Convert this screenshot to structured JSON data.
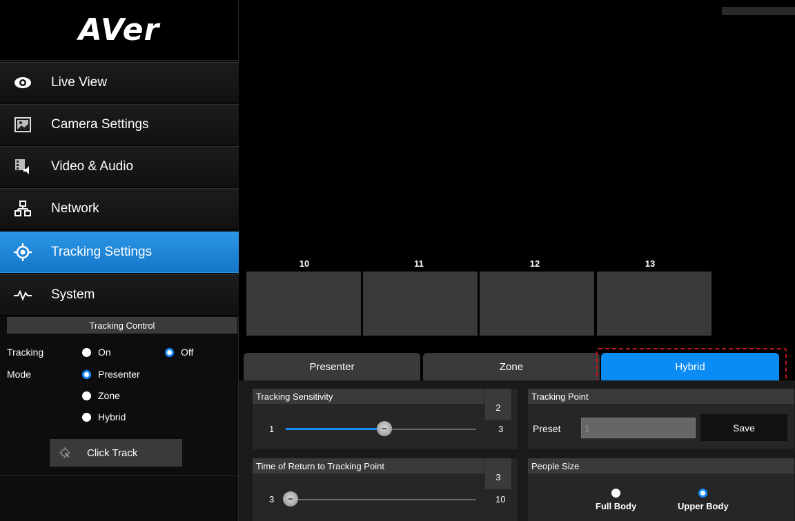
{
  "brand": {
    "logo_text": "AVer"
  },
  "sidebar": {
    "items": [
      {
        "label": "Live View",
        "icon": "eye-icon"
      },
      {
        "label": "Camera Settings",
        "icon": "image-icon"
      },
      {
        "label": "Video & Audio",
        "icon": "video-audio-icon"
      },
      {
        "label": "Network",
        "icon": "network-icon"
      },
      {
        "label": "Tracking Settings",
        "icon": "crosshair-icon",
        "active": true
      },
      {
        "label": "System",
        "icon": "pulse-icon"
      }
    ]
  },
  "tracking_control": {
    "header": "Tracking Control",
    "tracking_label": "Tracking",
    "tracking_options": {
      "on": "On",
      "off": "Off",
      "selected": "Off"
    },
    "mode_label": "Mode",
    "mode_options": {
      "presenter": "Presenter",
      "zone": "Zone",
      "hybrid": "Hybrid",
      "selected": "Presenter"
    },
    "click_track_label": "Click Track"
  },
  "presets": [
    {
      "number": "10"
    },
    {
      "number": "11"
    },
    {
      "number": "12"
    },
    {
      "number": "13"
    }
  ],
  "tabs": {
    "presenter": "Presenter",
    "zone": "Zone",
    "hybrid": "Hybrid",
    "active": "Hybrid"
  },
  "tracking_sensitivity": {
    "title": "Tracking Sensitivity",
    "value": "2",
    "min": "1",
    "max": "3",
    "level": 2
  },
  "tracking_point": {
    "title": "Tracking Point",
    "preset_label": "Preset",
    "preset_value": "1",
    "save_label": "Save"
  },
  "return_time": {
    "title": "Time of Return to Tracking Point",
    "value": "3",
    "min": "3",
    "max": "10",
    "level": 3
  },
  "people_size": {
    "title": "People Size",
    "full_body": "Full Body",
    "upper_body": "Upper Body",
    "selected": "Upper Body"
  },
  "colors": {
    "accent": "#1a8cff",
    "active_nav": "#1e86d8",
    "highlight_outline": "#c0151b"
  }
}
